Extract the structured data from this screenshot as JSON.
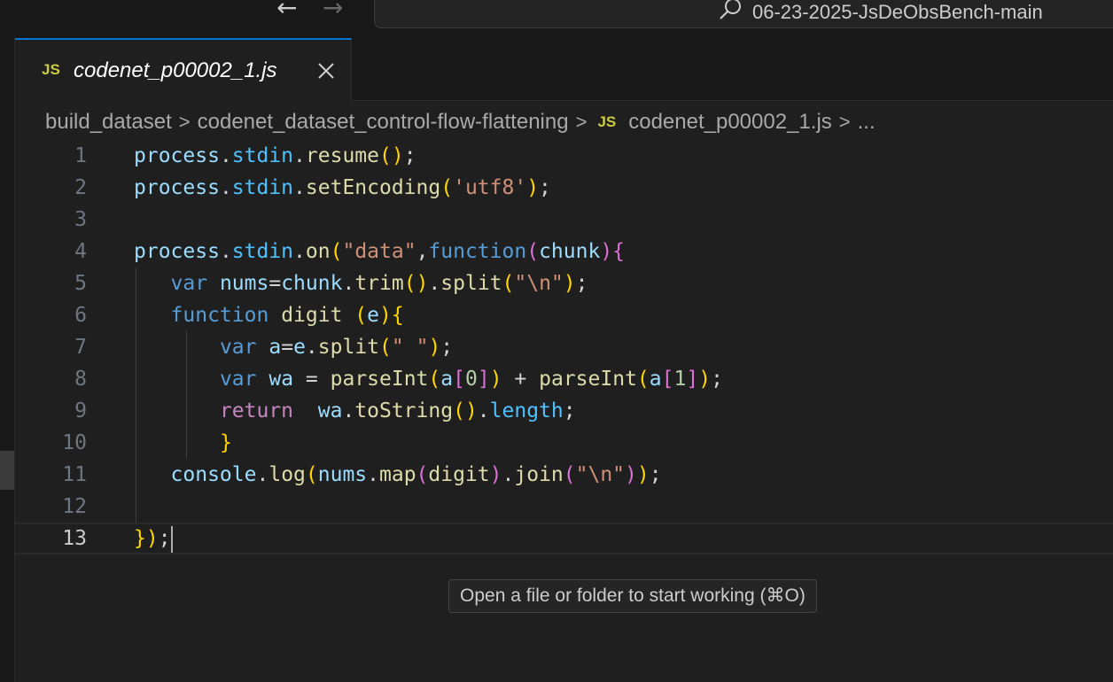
{
  "titlebar": {
    "back_icon": "arrow-left-icon",
    "forward_icon": "arrow-right-icon",
    "search_icon": "search-icon",
    "workspace_title": "06-23-2025-JsDeObsBench-main"
  },
  "tab": {
    "file_icon": "JS",
    "label": "codenet_p00002_1.js",
    "close_icon": "close-icon"
  },
  "breadcrumb": {
    "items": [
      "build_dataset",
      "codenet_dataset_control-flow-flattening"
    ],
    "file_icon": "JS",
    "file": "codenet_p00002_1.js",
    "trailing": "...",
    "separator": ">"
  },
  "editor": {
    "current_line": 13,
    "lines": [
      {
        "n": "1",
        "code": "process.stdin.resume();"
      },
      {
        "n": "2",
        "code": "process.stdin.setEncoding('utf8');"
      },
      {
        "n": "3",
        "code": ""
      },
      {
        "n": "4",
        "code": "process.stdin.on(\"data\",function(chunk){"
      },
      {
        "n": "5",
        "code": "   var nums=chunk.trim().split(\"\\n\");"
      },
      {
        "n": "6",
        "code": "   function digit (e){"
      },
      {
        "n": "7",
        "code": "       var a=e.split(\" \");"
      },
      {
        "n": "8",
        "code": "       var wa = parseInt(a[0]) + parseInt(a[1]);"
      },
      {
        "n": "9",
        "code": "       return  wa.toString().length;"
      },
      {
        "n": "10",
        "code": "       }"
      },
      {
        "n": "11",
        "code": "   console.log(nums.map(digit).join(\"\\n\"));"
      },
      {
        "n": "12",
        "code": ""
      },
      {
        "n": "13",
        "code": "});"
      }
    ]
  },
  "hover_hint": "Open a file or folder to start working (⌘O)",
  "colors": {
    "accent": "#0078d4",
    "js_badge": "#cbcb41",
    "editor_bg": "#1f1f1f"
  }
}
